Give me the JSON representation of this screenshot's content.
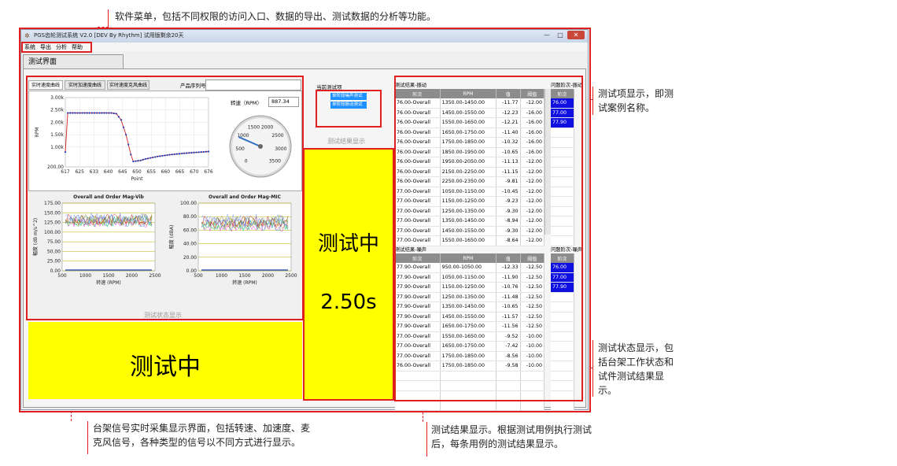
{
  "annotations": {
    "menu": "软件菜单，包括不同权限的访问入口、数据的导出、测试数据的分析等功能。",
    "case_name_l1": "测试项显示，即测",
    "case_name_l2": "试案例名称。",
    "status_l1": "测试状态显示，包",
    "status_l2": "括台架工作状态和",
    "status_l3": "试件测试结果显",
    "status_l4": "示。",
    "signal_l1": "台架信号实时采集显示界面，包括转速、加速度、麦",
    "signal_l2": "克风信号，各种类型的信号以不同方式进行显示。",
    "result_l1": "测试结果显示。根据测试用例执行测试",
    "result_l2": "后，每条用例的测试结果显示。"
  },
  "window": {
    "title": "PGS齿轮测试系统 V2.0 [DEV By Rhythm]  试用版剩余20天",
    "min": "—",
    "max": "□",
    "close": "✕"
  },
  "menu": [
    "系统",
    "导出",
    "分析",
    "帮助"
  ],
  "main_tab": "测试界面",
  "left_panel": {
    "tabs": [
      "实时速度曲线",
      "实时加速度曲线",
      "实时速度克风曲线"
    ],
    "serial_label": "产品序列号",
    "serial_value": "",
    "speed_label": "转速（RPM）",
    "speed_value": "887.34",
    "gauge_ticks": [
      "0",
      "500",
      "1000",
      "1500",
      "2000",
      "2500",
      "3000",
      "3500"
    ],
    "status_caption": "测试状态显示"
  },
  "middle_panel": {
    "current_label": "当前测试项",
    "items": [
      "单阶段噪声测试",
      "单阶段振动测试"
    ],
    "result_caption": "测试结果显示",
    "status_text": "测试中",
    "time_text": "2.50s"
  },
  "bottom_status": "测试中",
  "vib_table": {
    "title": "测试结果-振动",
    "side_title": "问题阶次-振动",
    "headers": [
      "阶次",
      "RPM",
      "值",
      "阈值"
    ],
    "side_header": "阶次",
    "rows": [
      [
        "76.00-Overall",
        "1350.00-1450.00",
        "-11.77",
        "-12.00"
      ],
      [
        "76.00-Overall",
        "1450.00-1550.00",
        "-12.23",
        "-16.00"
      ],
      [
        "76.00-Overall",
        "1550.00-1650.00",
        "-12.21",
        "-16.00"
      ],
      [
        "76.00-Overall",
        "1650.00-1750.00",
        "-11.40",
        "-16.00"
      ],
      [
        "76.00-Overall",
        "1750.00-1850.00",
        "-10.32",
        "-16.00"
      ],
      [
        "76.00-Overall",
        "1850.00-1950.00",
        "-10.65",
        "-16.00"
      ],
      [
        "76.00-Overall",
        "1950.00-2050.00",
        "-11.13",
        "-12.00"
      ],
      [
        "76.00-Overall",
        "2150.00-2250.00",
        "-11.15",
        "-12.00"
      ],
      [
        "76.00-Overall",
        "2250.00-2350.00",
        "-9.81",
        "-12.00"
      ],
      [
        "77.00-Overall",
        "1050.00-1150.00",
        "-10.45",
        "-12.00"
      ],
      [
        "77.00-Overall",
        "1150.00-1250.00",
        "-9.23",
        "-12.00"
      ],
      [
        "77.00-Overall",
        "1250.00-1350.00",
        "-9.30",
        "-12.00"
      ],
      [
        "77.00-Overall",
        "1350.00-1450.00",
        "-8.94",
        "-12.00"
      ],
      [
        "77.00-Overall",
        "1450.00-1550.00",
        "-9.30",
        "-12.00"
      ],
      [
        "77.00-Overall",
        "1550.00-1650.00",
        "-8.64",
        "-12.00"
      ]
    ],
    "side_rows": [
      "76.00",
      "77.00",
      "77.90"
    ]
  },
  "noise_table": {
    "title": "测试结果-噪声",
    "side_title": "问题阶次-噪声",
    "headers": [
      "阶次",
      "RPM",
      "值",
      "阈值"
    ],
    "side_header": "阶次",
    "rows": [
      [
        "77.90-Overall",
        "950.00-1050.00",
        "-12.33",
        "-12.50"
      ],
      [
        "77.90-Overall",
        "1050.00-1150.00",
        "-11.90",
        "-12.50"
      ],
      [
        "77.90-Overall",
        "1150.00-1250.00",
        "-10.76",
        "-12.50"
      ],
      [
        "77.90-Overall",
        "1250.00-1350.00",
        "-11.48",
        "-12.50"
      ],
      [
        "77.90-Overall",
        "1350.00-1450.00",
        "-10.65",
        "-12.50"
      ],
      [
        "77.90-Overall",
        "1450.00-1550.00",
        "-11.57",
        "-12.50"
      ],
      [
        "77.90-Overall",
        "1650.00-1750.00",
        "-11.56",
        "-12.50"
      ],
      [
        "77.00-Overall",
        "1550.00-1650.00",
        "-9.52",
        "-10.00"
      ],
      [
        "77.00-Overall",
        "1650.00-1750.00",
        "-7.42",
        "-10.00"
      ],
      [
        "77.00-Overall",
        "1750.00-1850.00",
        "-8.56",
        "-10.00"
      ],
      [
        "76.00-Overall",
        "1750.00-1850.00",
        "-9.58",
        "-10.00"
      ]
    ],
    "side_rows": [
      "76.00",
      "77.00",
      "77.90"
    ]
  },
  "chart_data": [
    {
      "type": "line",
      "xlabel": "Point",
      "ylabel": "RPM",
      "xticks": [
        "617",
        "625",
        "633",
        "640",
        "645",
        "650",
        "655",
        "660",
        "665",
        "670",
        "676"
      ],
      "yticks": [
        "200.00",
        "1.00k",
        "1.50k",
        "2.00k",
        "2.50k",
        "3.00k"
      ],
      "xlim": [
        617,
        676
      ],
      "ylim": [
        200,
        3000
      ],
      "series": [
        {
          "x": [
            617,
            618,
            620,
            625,
            630,
            633,
            636,
            638,
            640,
            642,
            644,
            645,
            648,
            650,
            655,
            660,
            665,
            670,
            676
          ],
          "values": [
            800,
            2380,
            2380,
            2380,
            2380,
            2380,
            2380,
            2350,
            2100,
            1500,
            700,
            420,
            460,
            520,
            620,
            690,
            740,
            780,
            820
          ]
        }
      ]
    },
    {
      "type": "line",
      "title": "Overall and Order Mag-Vib",
      "xlabel": "转速 (RPM)",
      "ylabel": "幅度 (dB m/s^2)",
      "xticks": [
        "500",
        "1000",
        "1500",
        "2000",
        "2500"
      ],
      "yticks": [
        "0.00",
        "25.00",
        "50.00",
        "75.00",
        "100.00",
        "125.00",
        "150.00",
        "175.00"
      ],
      "xlim": [
        500,
        2500
      ],
      "ylim": [
        0,
        175
      ]
    },
    {
      "type": "line",
      "title": "Overall and Order Mag-MIC",
      "xlabel": "转速 (RPM)",
      "ylabel": "幅度 (dBA)",
      "xticks": [
        "500",
        "1000",
        "1500",
        "2000",
        "2500"
      ],
      "yticks": [
        "0.00",
        "20.00",
        "40.00",
        "60.00",
        "80.00",
        "100.00"
      ],
      "xlim": [
        500,
        2500
      ],
      "ylim": [
        0,
        100
      ]
    }
  ]
}
